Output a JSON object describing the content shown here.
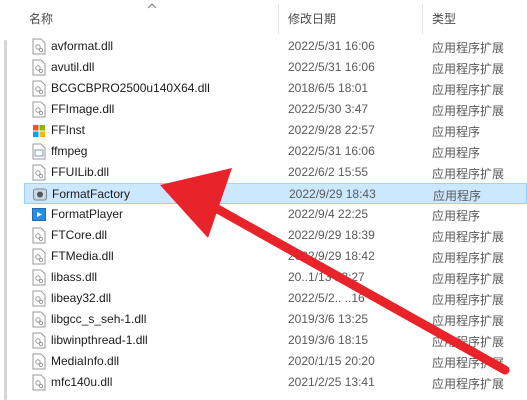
{
  "columns": {
    "name": "名称",
    "date": "修改日期",
    "type": "类型"
  },
  "files": [
    {
      "name": "avformat.dll",
      "date": "2022/5/31 16:06",
      "type": "应用程序扩展",
      "icon": "dll-file-icon"
    },
    {
      "name": "avutil.dll",
      "date": "2022/5/31 16:06",
      "type": "应用程序扩展",
      "icon": "dll-file-icon"
    },
    {
      "name": "BCGCBPRO2500u140X64.dll",
      "date": "2018/6/5 18:01",
      "type": "应用程序扩展",
      "icon": "dll-file-icon"
    },
    {
      "name": "FFImage.dll",
      "date": "2022/5/30 3:47",
      "type": "应用程序扩展",
      "icon": "dll-file-icon"
    },
    {
      "name": "FFInst",
      "date": "2022/9/28 22:57",
      "type": "应用程序",
      "icon": "windows-installer-icon"
    },
    {
      "name": "ffmpeg",
      "date": "2022/5/31 16:06",
      "type": "应用程序",
      "icon": "exe-file-icon"
    },
    {
      "name": "FFUILib.dll",
      "date": "2022/6/2 15:55",
      "type": "应用程序扩展",
      "icon": "dll-file-icon"
    },
    {
      "name": "FormatFactory",
      "date": "2022/9/29 18:43",
      "type": "应用程序",
      "icon": "format-factory-icon"
    },
    {
      "name": "FormatPlayer",
      "date": "2022/9/4 22:25",
      "type": "应用程序",
      "icon": "format-player-icon"
    },
    {
      "name": "FTCore.dll",
      "date": "2022/9/29 18:39",
      "type": "应用程序扩展",
      "icon": "dll-file-icon"
    },
    {
      "name": "FTMedia.dll",
      "date": "2022/9/29 18:42",
      "type": "应用程序扩展",
      "icon": "dll-file-icon"
    },
    {
      "name": "libass.dll",
      "date": "20..1/13 13:27",
      "type": "应用程序扩展",
      "icon": "dll-file-icon"
    },
    {
      "name": "libeay32.dll",
      "date": "2022/5/2.. ..16",
      "type": "应用程序扩展",
      "icon": "dll-file-icon"
    },
    {
      "name": "libgcc_s_seh-1.dll",
      "date": "2019/3/6 13:25",
      "type": "应用程序扩展",
      "icon": "dll-file-icon"
    },
    {
      "name": "libwinpthread-1.dll",
      "date": "2019/3/6 18:15",
      "type": "应用程序扩展",
      "icon": "dll-file-icon"
    },
    {
      "name": "MediaInfo.dll",
      "date": "2020/1/15 20:20",
      "type": "应用程序扩展",
      "icon": "dll-file-icon"
    },
    {
      "name": "mfc140u.dll",
      "date": "2021/2/25 13:41",
      "type": "应用程序扩展",
      "icon": "dll-file-icon"
    }
  ],
  "selected_index": 7,
  "colors": {
    "selection_bg": "#cce8ff",
    "selection_border": "#99d1ff",
    "arrow": "#e8232a"
  }
}
